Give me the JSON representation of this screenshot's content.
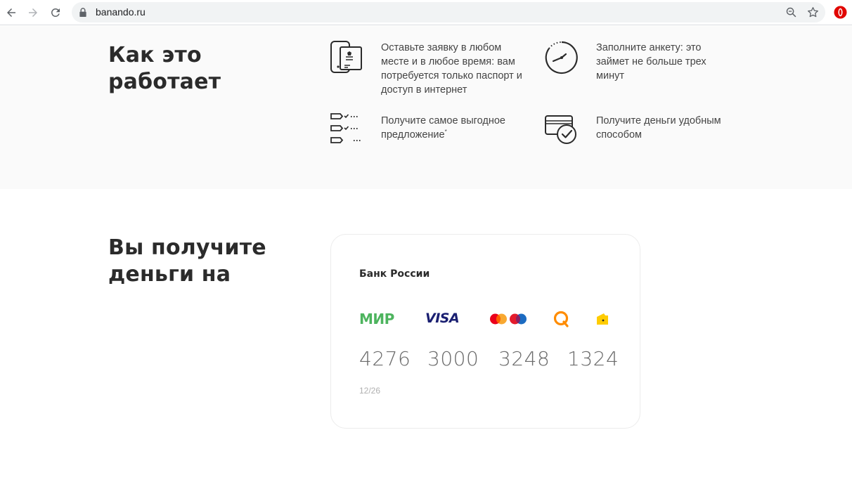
{
  "browser": {
    "url": "banando.ru"
  },
  "how_it_works": {
    "title": "Как это работает",
    "steps": [
      {
        "icon": "phone-passport-icon",
        "text": "Оставьте заявку в любом месте и в любое время: вам потребуется только паспорт и доступ в интернет"
      },
      {
        "icon": "clock-icon",
        "text": "Заполните анкету: это займет не больше трех минут"
      },
      {
        "icon": "checklist-icon",
        "text": "Получите самое выгодное предложение",
        "note_mark": "*"
      },
      {
        "icon": "card-check-icon",
        "text": "Получите деньги удобным способом"
      }
    ]
  },
  "receive": {
    "title": "Вы получите деньги на",
    "card": {
      "bank": "Банк России",
      "logos": {
        "mir": "МИР",
        "visa": "VISA",
        "mastercard": "mastercard-logo-icon",
        "maestro": "maestro-logo-icon",
        "qiwi": "qiwi-logo-icon",
        "yandex": "yandex-money-logo-icon"
      },
      "number_groups": [
        "4276",
        "3000",
        "3248",
        "1324"
      ],
      "expiry": "12/26"
    }
  },
  "colors": {
    "section_bg": "#fafafa",
    "title": "#2b2b2b",
    "mir_green": "#4db45e",
    "visa_blue": "#1a1f71",
    "mc_red": "#eb001b",
    "mc_orange": "#f79e1b",
    "qiwi_orange": "#ff8c00",
    "yandex_yellow": "#ffcc00"
  }
}
